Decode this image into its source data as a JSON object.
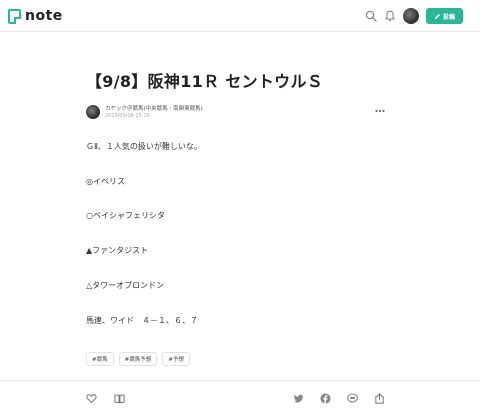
{
  "header": {
    "logo_text": "note",
    "post_button_label": "投稿",
    "icons": [
      "search-icon",
      "bell-icon",
      "avatar",
      "pen-icon"
    ]
  },
  "article": {
    "title": "【9/8】阪神11Ｒ セントウルＳ",
    "author_name": "カヤック＠競馬(中央競馬・南関東競馬)",
    "date": "2019/09/08 15:19",
    "lines": [
      "ＧⅡ、１人気の扱いが難しいな。",
      "◎イベリス",
      "○ペイシャフェリシタ",
      "▲ファンタジスト",
      "△タワーオブロンドン",
      "馬連、ワイド　４－１、６、７"
    ],
    "tags": [
      "#競馬",
      "#競馬予想",
      "#予想"
    ]
  },
  "footer": {
    "icons": [
      "heart-icon",
      "magazine-icon",
      "twitter-icon",
      "facebook-icon",
      "line-icon",
      "share-icon"
    ]
  },
  "colors": {
    "accent": "#2cb696",
    "text": "#222222",
    "muted": "#aaaaaa",
    "border": "#ececec"
  }
}
